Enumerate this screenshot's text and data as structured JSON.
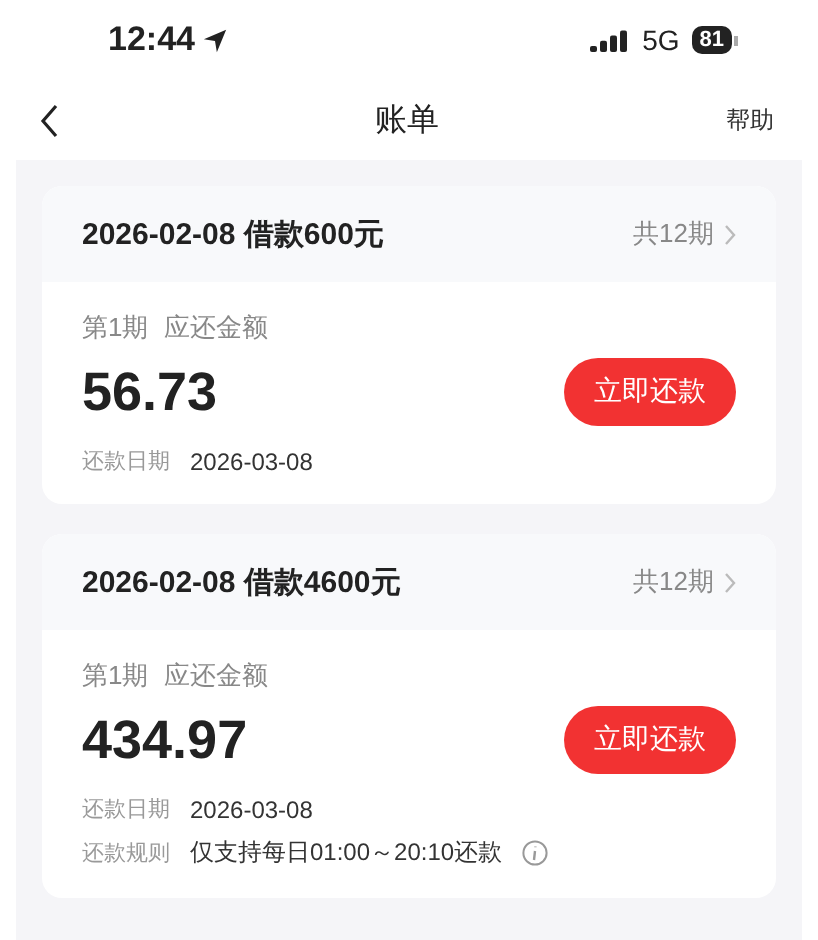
{
  "status_bar": {
    "time": "12:44",
    "network": "5G",
    "battery": "81"
  },
  "nav": {
    "title": "账单",
    "action": "帮助"
  },
  "loans": [
    {
      "title": "2026-02-08 借款600元",
      "periods": "共12期",
      "installment": "第1期",
      "amount_label": "应还金额",
      "amount": "56.73",
      "button": "立即还款",
      "details": [
        {
          "label": "还款日期",
          "value": "2026-03-08",
          "info": false
        }
      ]
    },
    {
      "title": "2026-02-08 借款4600元",
      "periods": "共12期",
      "installment": "第1期",
      "amount_label": "应还金额",
      "amount": "434.97",
      "button": "立即还款",
      "details": [
        {
          "label": "还款日期",
          "value": "2026-03-08",
          "info": false
        },
        {
          "label": "还款规则",
          "value": "仅支持每日01:00～20:10还款",
          "info": true
        }
      ]
    }
  ]
}
